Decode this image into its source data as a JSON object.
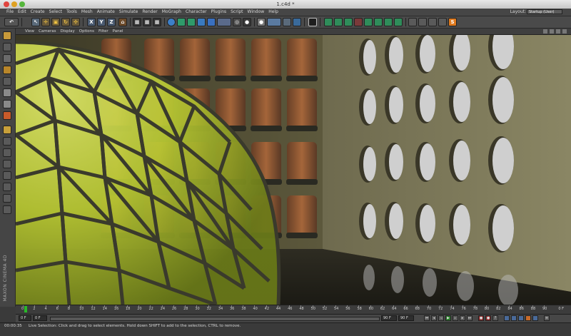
{
  "window": {
    "title": "1.c4d *"
  },
  "menubar": {
    "items": [
      "File",
      "Edit",
      "Create",
      "Select",
      "Tools",
      "Mesh",
      "Animate",
      "Simulate",
      "Render",
      "MoGraph",
      "Character",
      "Plugins",
      "Script",
      "Window",
      "Help"
    ],
    "layout_label": "Layout:",
    "layout_value": "Startup (User)"
  },
  "toolbar": {
    "axis_x": "X",
    "axis_y": "Y",
    "axis_z": "Z"
  },
  "viewport": {
    "menu": [
      "View",
      "Cameras",
      "Display",
      "Options",
      "Filter",
      "Panel"
    ]
  },
  "timeline": {
    "ticks": [
      "0",
      "2",
      "4",
      "6",
      "8",
      "10",
      "12",
      "14",
      "16",
      "18",
      "20",
      "22",
      "24",
      "26",
      "28",
      "30",
      "32",
      "34",
      "36",
      "38",
      "40",
      "42",
      "44",
      "46",
      "48",
      "50",
      "52",
      "54",
      "56",
      "58",
      "60",
      "62",
      "64",
      "66",
      "68",
      "70",
      "72",
      "74",
      "76",
      "78",
      "80",
      "82",
      "84",
      "86",
      "88",
      "90"
    ],
    "end_label": "0 F"
  },
  "transport": {
    "start_field": "0 F",
    "current_field": "0 F",
    "end_field": "90 F",
    "max_field": "90 F"
  },
  "status": {
    "time": "00:00:35",
    "message": "Live Selection: Click and drag to select elements. Hold down SHIFT to add to the selection, CTRL to remove."
  },
  "branding": {
    "maxon": "MAXON CINEMA 4D"
  },
  "colors": {
    "accent": "#28b928",
    "dome": "#b8c832"
  }
}
